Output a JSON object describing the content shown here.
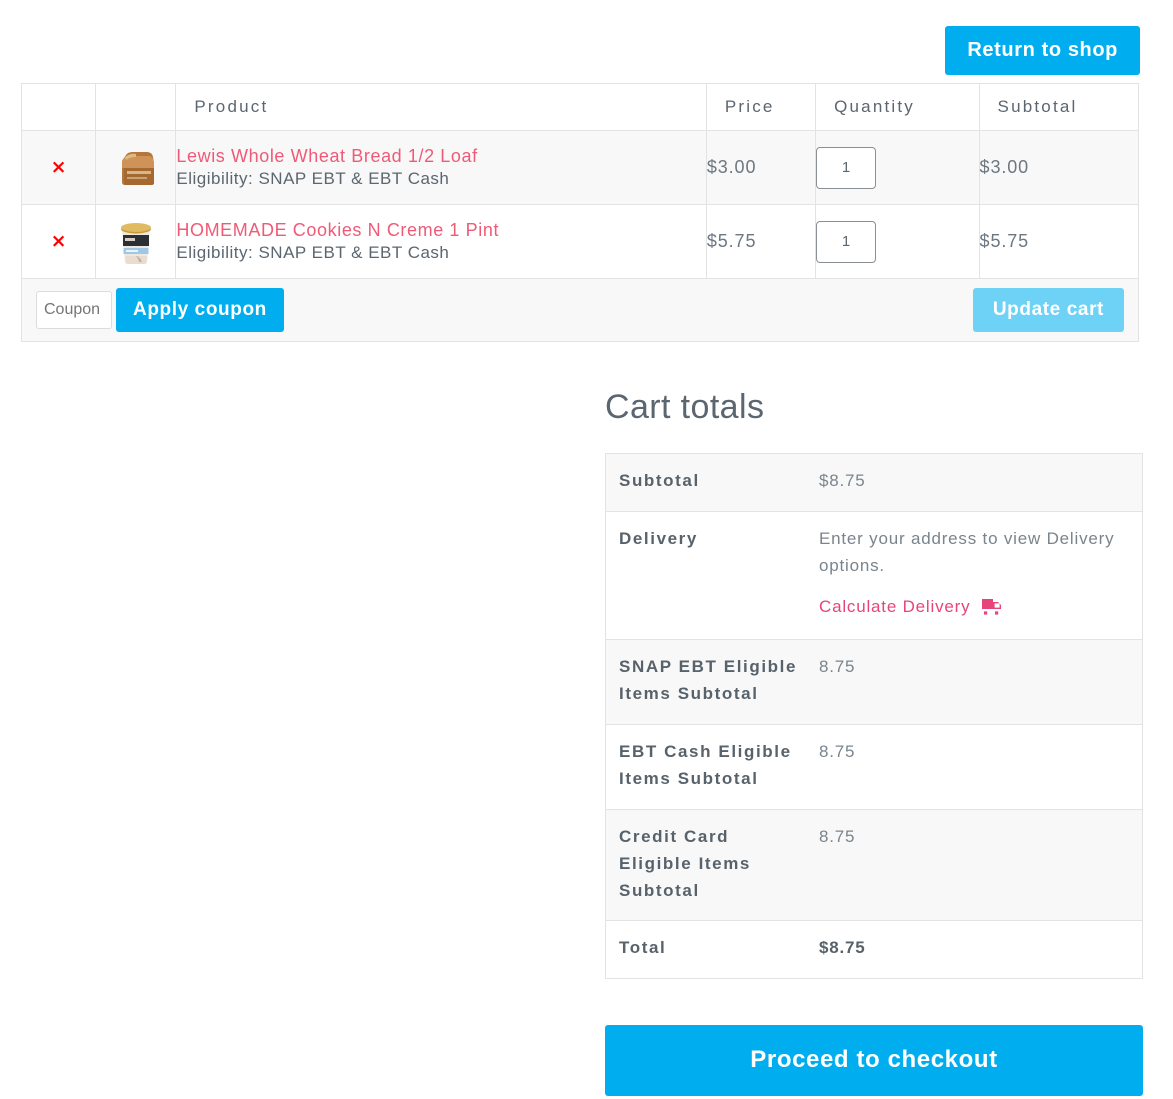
{
  "header": {
    "return_to_shop": "Return to shop"
  },
  "cart_table": {
    "columns": [
      "",
      "",
      "Product",
      "Price",
      "Quantity",
      "Subtotal"
    ],
    "remove_icon": "×",
    "rows": [
      {
        "remove_label": "×",
        "thumbnail": "bread-loaf-thumbnail",
        "name": "Lewis Whole Wheat Bread 1/2 Loaf",
        "eligibility": "Eligibility: SNAP EBT & EBT Cash",
        "price": "$3.00",
        "quantity": "1",
        "subtotal": "$3.00"
      },
      {
        "remove_label": "×",
        "thumbnail": "ice-cream-pint-thumbnail",
        "name": "HOMEMADE Cookies N Creme 1 Pint",
        "eligibility": "Eligibility: SNAP EBT & EBT Cash",
        "price": "$5.75",
        "quantity": "1",
        "subtotal": "$5.75"
      }
    ],
    "coupon": {
      "placeholder": "Coupon code",
      "value": "",
      "apply_label": "Apply coupon",
      "update_label": "Update cart"
    }
  },
  "cart_totals": {
    "title": "Cart totals",
    "rows": [
      {
        "label": "Subtotal",
        "value": "$8.75"
      },
      {
        "label": "Delivery",
        "value": "Enter your address to view Delivery options.",
        "link": "Calculate Delivery",
        "link_icon": "delivery-truck-icon"
      },
      {
        "label": "SNAP EBT Eligible Items Subtotal",
        "value": "8.75"
      },
      {
        "label": "EBT Cash Eligible Items Subtotal",
        "value": "8.75"
      },
      {
        "label": "Credit Card Eligible Items Subtotal",
        "value": "8.75"
      },
      {
        "label": "Total",
        "value": "$8.75"
      }
    ],
    "checkout_label": "Proceed to checkout"
  },
  "colors": {
    "accent_blue": "#00aeef",
    "accent_blue_light": "#6ed2f7",
    "link_pink": "#ef5a76",
    "crimson": "#e6457a",
    "remove_red": "#ff0000",
    "text": "#5b6670",
    "row_stripe": "#f8f8f8",
    "border": "#e3e3e3"
  }
}
